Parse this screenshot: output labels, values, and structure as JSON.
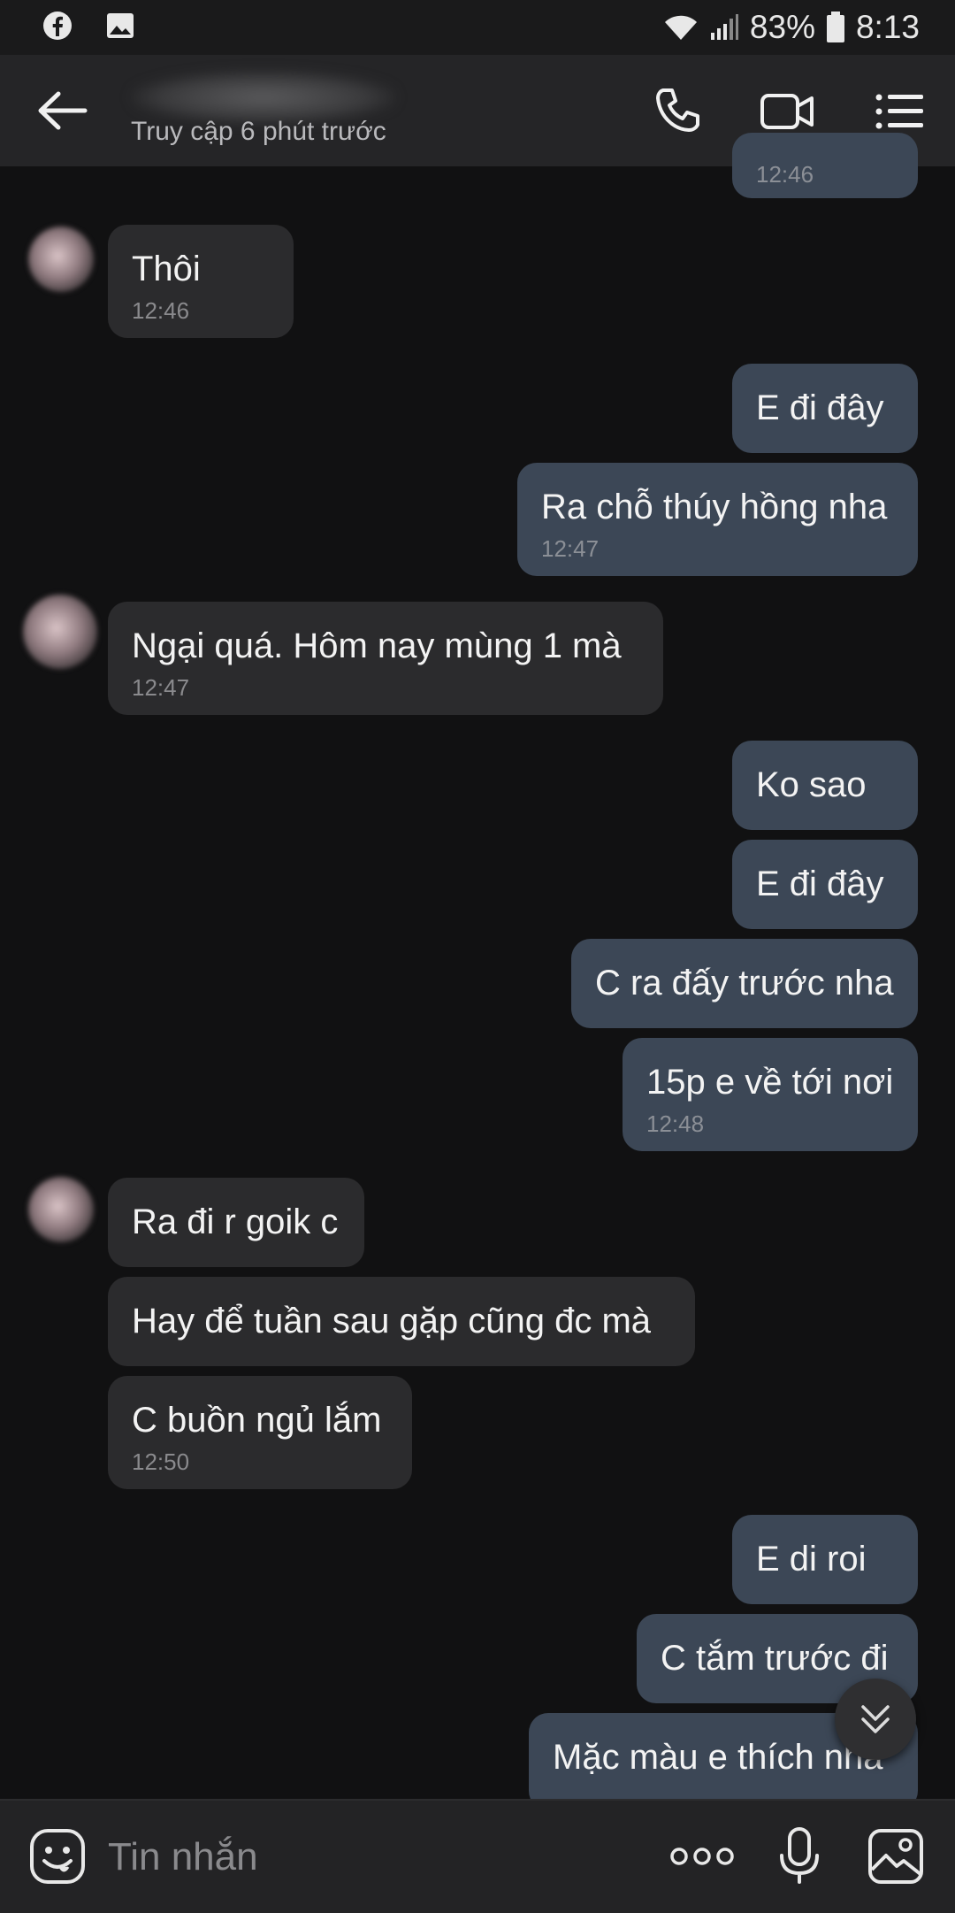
{
  "status_bar": {
    "left_icons": [
      "facebook-icon",
      "image-icon"
    ],
    "battery": "83%",
    "time": "8:13"
  },
  "header": {
    "contact_status": "Truy cập 6 phút trước",
    "icons": [
      "back-arrow-icon",
      "phone-icon",
      "video-call-icon",
      "menu-list-icon"
    ]
  },
  "messages": [
    {
      "dir": "out",
      "text": "",
      "time": "12:46"
    },
    {
      "dir": "in",
      "text": "Thôi",
      "time": "12:46"
    },
    {
      "dir": "out",
      "text": "E đi đây",
      "time": ""
    },
    {
      "dir": "out",
      "text": "Ra chỗ thúy hồng nha",
      "time": "12:47"
    },
    {
      "dir": "in",
      "text": "Ngại quá. Hôm nay mùng 1 mà",
      "time": "12:47"
    },
    {
      "dir": "out",
      "text": "Ko sao",
      "time": ""
    },
    {
      "dir": "out",
      "text": "E đi đây",
      "time": ""
    },
    {
      "dir": "out",
      "text": "C ra đấy trước nha",
      "time": ""
    },
    {
      "dir": "out",
      "text": "15p e về tới nơi",
      "time": "12:48"
    },
    {
      "dir": "in",
      "text": "Ra đi r goik c",
      "time": ""
    },
    {
      "dir": "in",
      "text": "Hay để tuần sau gặp cũng đc mà",
      "time": ""
    },
    {
      "dir": "in",
      "text": "C buồn ngủ lắm",
      "time": "12:50"
    },
    {
      "dir": "out",
      "text": "E di roi",
      "time": ""
    },
    {
      "dir": "out",
      "text": "C tắm trước đi",
      "time": ""
    },
    {
      "dir": "out",
      "text": "Mặc màu e thích nha",
      "time": ""
    }
  ],
  "input_bar": {
    "placeholder": "Tin nhắn",
    "icons": [
      "emoji-icon",
      "more-dots-icon",
      "microphone-icon",
      "gallery-icon"
    ]
  },
  "colors": {
    "background": "#111112",
    "header": "#252527",
    "incoming_bubble": "#2b2b2d",
    "outgoing_bubble": "#3c4756",
    "timestamp": "#8b8f96"
  }
}
